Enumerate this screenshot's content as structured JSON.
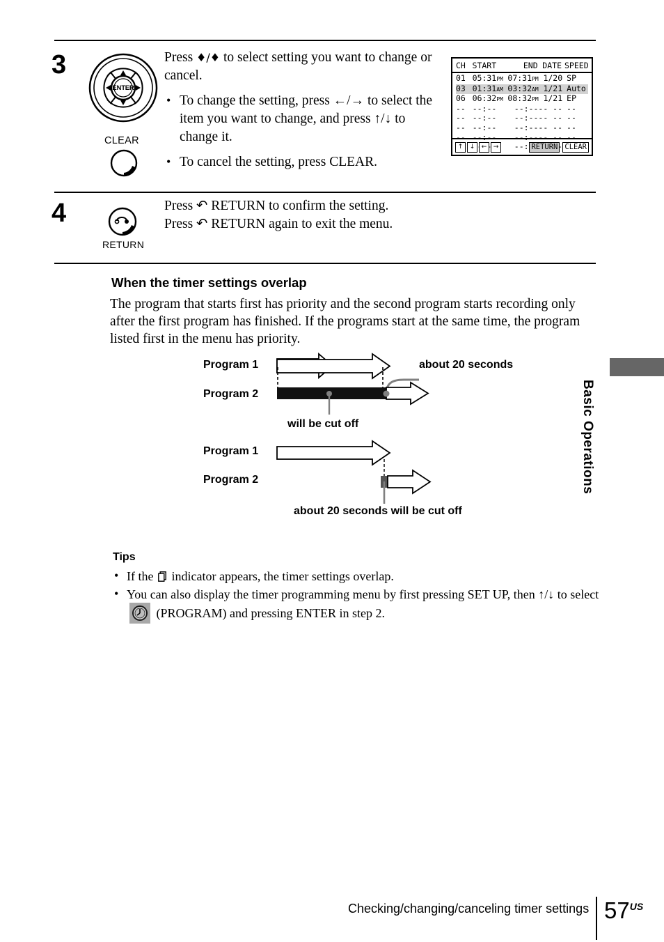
{
  "steps": [
    {
      "number": "3",
      "intro": "Press ♦/♦ to select setting you want to change or cancel.",
      "intro_pre": "Press ",
      "intro_arrows": "♦/♦",
      "intro_post": " to select setting you want to change or cancel.",
      "bullets": [
        "To change the setting, press ←/→ to select the item you want to change, and press ↑/↓ to change it.",
        "To cancel the setting, press CLEAR."
      ],
      "remote_labels": {
        "enter": "ENTER",
        "clear": "CLEAR"
      }
    },
    {
      "number": "4",
      "lines": [
        "Press ↶ RETURN to confirm the setting.",
        "Press ↶ RETURN again to exit the menu."
      ],
      "remote_labels": {
        "return": "RETURN"
      }
    }
  ],
  "osd": {
    "columns": [
      "CH",
      "START",
      "END",
      "DATE",
      "SPEED"
    ],
    "rows": [
      {
        "ch": "01",
        "start": "05:31",
        "start_ampm": "PM",
        "end": "07:31",
        "end_ampm": "PM",
        "date": "1/20",
        "speed": "SP",
        "highlighted": false
      },
      {
        "ch": "03",
        "start": "01:31",
        "start_ampm": "AM",
        "end": "03:32",
        "end_ampm": "AM",
        "date": "1/21",
        "speed": "Auto",
        "highlighted": true
      },
      {
        "ch": "06",
        "start": "06:32",
        "start_ampm": "PM",
        "end": "08:32",
        "end_ampm": "PM",
        "date": "1/21",
        "speed": "EP",
        "highlighted": false
      },
      {
        "ch": "--",
        "start": "--:--",
        "start_ampm": "",
        "end": "--:--",
        "end_ampm": "",
        "date": "-- --",
        "speed": "--",
        "highlighted": false
      },
      {
        "ch": "--",
        "start": "--:--",
        "start_ampm": "",
        "end": "--:--",
        "end_ampm": "",
        "date": "-- --",
        "speed": "--",
        "highlighted": false
      },
      {
        "ch": "--",
        "start": "--:--",
        "start_ampm": "",
        "end": "--:--",
        "end_ampm": "",
        "date": "-- --",
        "speed": "--",
        "highlighted": false
      },
      {
        "ch": "--",
        "start": "--:--",
        "start_ampm": "",
        "end": "--:--",
        "end_ampm": "",
        "date": "-- --",
        "speed": "--",
        "highlighted": false
      },
      {
        "ch": "--",
        "start": "--:--",
        "start_ampm": "",
        "end": "--:--",
        "end_ampm": "",
        "date": "-- --",
        "speed": "--",
        "highlighted": false
      }
    ],
    "footer": {
      "arrows": [
        "↑",
        "↓",
        "←",
        "→"
      ],
      "return_label": "RETURN",
      "clear_label": "CLEAR"
    }
  },
  "section": {
    "heading": "When the timer settings overlap",
    "paragraph": "The program that starts first has priority and the second program starts recording only after the first program has finished. If the programs start at the same time, the program listed first in the menu has priority."
  },
  "diagram1": {
    "label_program1": "Program 1",
    "label_program2": "Program 2",
    "annotation_right": "about 20 seconds",
    "annotation_bottom": "will be cut off"
  },
  "diagram2": {
    "label_program1": "Program 1",
    "label_program2": "Program 2",
    "annotation_bottom": "about 20 seconds will be cut off"
  },
  "tips": {
    "heading": "Tips",
    "item1_pre": "If the ",
    "item1_post": " indicator appears, the timer settings overlap.",
    "item2_pre": "You can also display the timer programming menu by first pressing SET UP, then ↑/↓ to select ",
    "item2_post": " (PROGRAM) and pressing ENTER in step 2."
  },
  "side_tab": {
    "label": "Basic Operations",
    "color": "#666666"
  },
  "footer": {
    "title": "Checking/changing/canceling timer settings",
    "page": "57",
    "page_suffix": "US"
  }
}
